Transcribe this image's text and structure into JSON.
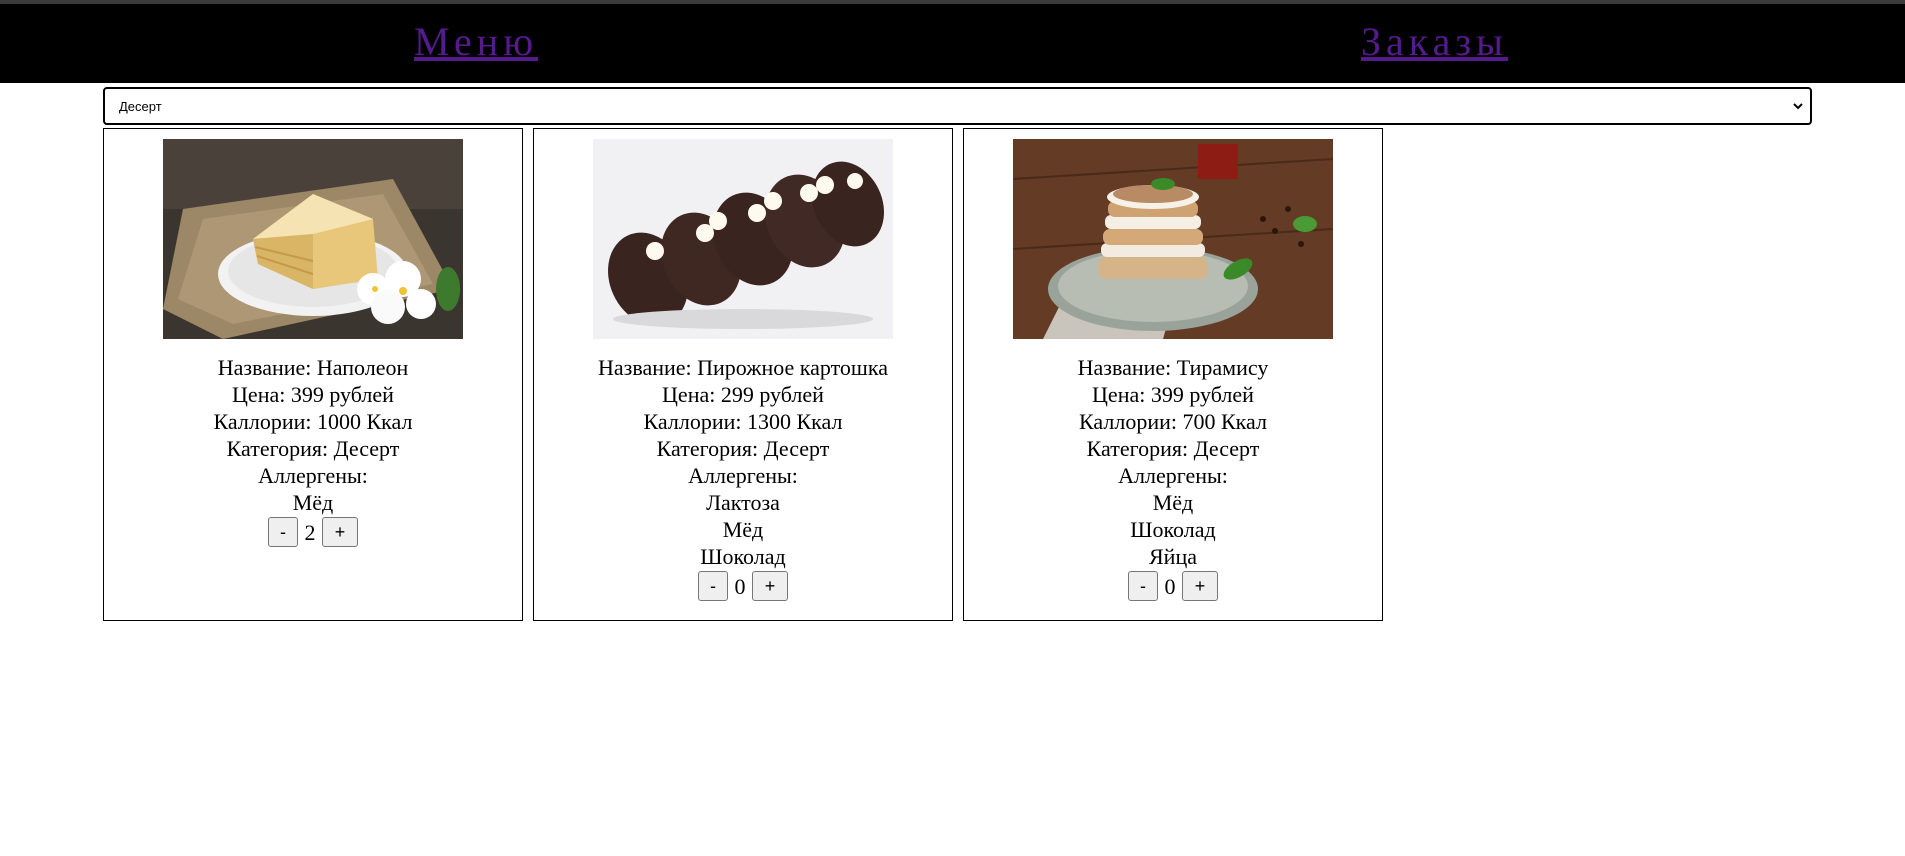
{
  "nav": {
    "menu": "Меню",
    "orders": "Заказы"
  },
  "filter": {
    "selected": "Десерт"
  },
  "colors": {
    "navbar": "#000000",
    "link": "#551a8b"
  },
  "labels": {
    "name": "Название:",
    "price": "Цена:",
    "calories": "Каллории:",
    "category": "Категория:",
    "allergens": "Аллергены:",
    "minus": "-",
    "plus": "+"
  },
  "items": [
    {
      "name": "Название: Наполеон",
      "price": "Цена: 399 рублей",
      "calories": "Каллории: 1000 Ккал",
      "category": "Категория: Десерт",
      "allergens_title": "Аллергены:",
      "allergens": [
        "Мёд"
      ],
      "quantity": "2"
    },
    {
      "name": "Название: Пирожное картошка",
      "price": "Цена: 299 рублей",
      "calories": "Каллории: 1300 Ккал",
      "category": "Категория: Десерт",
      "allergens_title": "Аллергены:",
      "allergens": [
        "Лактоза",
        "Мёд",
        "Шоколад"
      ],
      "quantity": "0"
    },
    {
      "name": "Название: Тирамису",
      "price": "Цена: 399 рублей",
      "calories": "Каллории: 700 Ккал",
      "category": "Категория: Десерт",
      "allergens_title": "Аллергены:",
      "allergens": [
        "Мёд",
        "Шоколад",
        "Яйца"
      ],
      "quantity": "0"
    }
  ]
}
